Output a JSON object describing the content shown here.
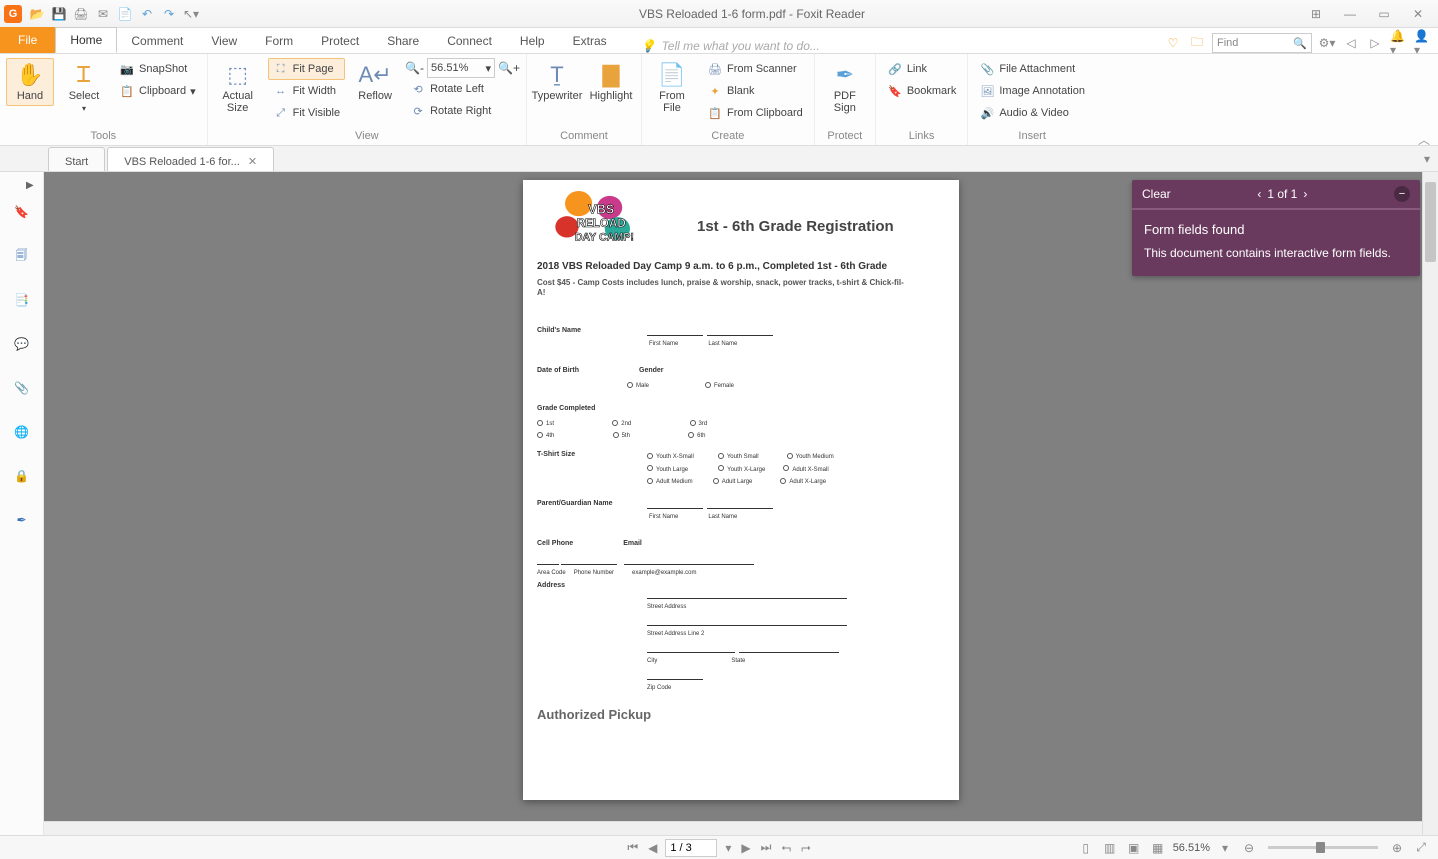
{
  "title": "VBS Reloaded 1-6 form.pdf - Foxit Reader",
  "qat": [
    "open",
    "save",
    "print",
    "email",
    "scan",
    "undo",
    "redo",
    "cursor"
  ],
  "menus": {
    "file": "File",
    "home": "Home",
    "comment": "Comment",
    "view": "View",
    "form": "Form",
    "protect": "Protect",
    "share": "Share",
    "connect": "Connect",
    "help": "Help",
    "extras": "Extras"
  },
  "tellme": "Tell me what you want to do...",
  "search_placeholder": "Find",
  "ribbon": {
    "tools": {
      "label": "Tools",
      "hand": "Hand",
      "select": "Select",
      "snapshot": "SnapShot",
      "clipboard": "Clipboard"
    },
    "view": {
      "label": "View",
      "actual": "Actual Size",
      "fitpage": "Fit Page",
      "fitwidth": "Fit Width",
      "fitvisible": "Fit Visible",
      "reflow": "Reflow",
      "zoom": "56.51%",
      "rotleft": "Rotate Left",
      "rotright": "Rotate Right"
    },
    "comment": {
      "label": "Comment",
      "typewriter": "Typewriter",
      "highlight": "Highlight"
    },
    "create": {
      "label": "Create",
      "fromfile": "From File",
      "fromscanner": "From Scanner",
      "blank": "Blank",
      "fromclipboard": "From Clipboard"
    },
    "protect": {
      "label": "Protect",
      "pdfsign": "PDF Sign"
    },
    "links": {
      "label": "Links",
      "link": "Link",
      "bookmark": "Bookmark"
    },
    "insert": {
      "label": "Insert",
      "fileatt": "File Attachment",
      "imganno": "Image Annotation",
      "av": "Audio & Video"
    }
  },
  "doctabs": {
    "start": "Start",
    "doc": "VBS Reloaded 1-6 for..."
  },
  "notification": {
    "clear": "Clear",
    "page": "1 of 1",
    "title": "Form fields found",
    "body": "This document contains interactive form fields."
  },
  "status": {
    "page_input": "1 / 3",
    "zoom": "56.51%"
  },
  "doc": {
    "heading": "1st - 6th Grade Registration",
    "h3": "2018 VBS Reloaded Day Camp 9 a.m. to 6 p.m., Completed 1st - 6th Grade",
    "sub": "Cost $45 - Camp Costs includes lunch, praise & worship, snack, power tracks, t-shirt & Chick-fil-A!",
    "childs_name": "Child's Name",
    "first_name": "First Name",
    "last_name": "Last Name",
    "dob": "Date of Birth",
    "gender": "Gender",
    "male": "Male",
    "female": "Female",
    "grade": "Grade Completed",
    "g1": "1st",
    "g2": "2nd",
    "g3": "3rd",
    "g4": "4th",
    "g5": "5th",
    "g6": "6th",
    "tshirt": "T-Shirt Size",
    "yxs": "Youth X-Small",
    "ys": "Youth Small",
    "ym": "Youth Medium",
    "yl": "Youth Large",
    "yxl": "Youth X-Large",
    "axs": "Adult X-Small",
    "am": "Adult Medium",
    "al": "Adult Large",
    "axl": "Adult X-Large",
    "parent": "Parent/Guardian Name",
    "cell": "Cell Phone",
    "email_l": "Email",
    "area": "Area Code",
    "phone": "Phone Number",
    "email_ex": "example@example.com",
    "address": "Address",
    "street": "Street Address",
    "street2": "Street Address Line 2",
    "city": "City",
    "state": "State",
    "zip": "Zip Code",
    "auth": "Authorized Pickup"
  }
}
